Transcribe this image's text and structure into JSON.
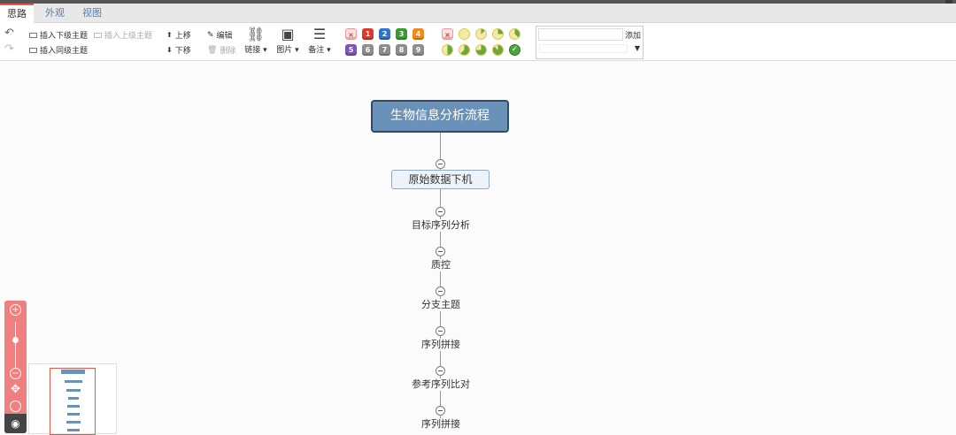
{
  "tabs": [
    {
      "label": "思路",
      "active": true
    },
    {
      "label": "外观",
      "active": false
    },
    {
      "label": "视图",
      "active": false
    }
  ],
  "toolbar": {
    "insert_child": "插入下级主题",
    "insert_parent": "插入上级主题",
    "insert_sibling": "插入同级主题",
    "move_up": "上移",
    "move_down": "下移",
    "edit": "编辑",
    "delete": "删除",
    "link": "链接",
    "image": "图片",
    "note": "备注",
    "add": "添加"
  },
  "priority": {
    "remove_icon": "×",
    "row1": [
      {
        "num": "1",
        "color": "#e0392b"
      },
      {
        "num": "2",
        "color": "#2f74c7"
      },
      {
        "num": "3",
        "color": "#3a9a2f"
      },
      {
        "num": "4",
        "color": "#ee8a1e"
      }
    ],
    "row2": [
      {
        "num": "5",
        "color": "#7b55b8"
      },
      {
        "num": "6",
        "color": "#8d8d8d"
      },
      {
        "num": "7",
        "color": "#8d8d8d"
      },
      {
        "num": "8",
        "color": "#8d8d8d"
      },
      {
        "num": "9",
        "color": "#8d8d8d"
      }
    ]
  },
  "progress": [
    0,
    0.125,
    0.25,
    0.375,
    0.5,
    0.625,
    0.75,
    0.875,
    1
  ],
  "mindmap": {
    "root": "生物信息分析流程",
    "main": "原始数据下机",
    "subtopics": [
      "目标序列分析",
      "质控",
      "分支主题",
      "序列拼接",
      "参考序列比对",
      "序列拼接"
    ]
  },
  "colors": {
    "accent": "#e05b4b",
    "root_fill": "#6a91b8",
    "root_border": "#2e4d6e",
    "zoom_panel": "#f08080"
  }
}
